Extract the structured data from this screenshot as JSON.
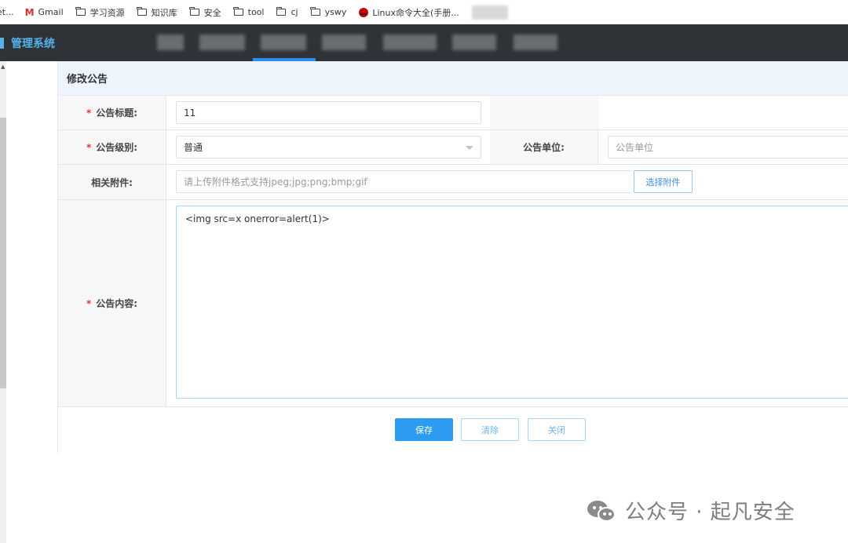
{
  "bookmarks": {
    "items": [
      {
        "label": "et...",
        "icon": "none"
      },
      {
        "label": "Gmail",
        "icon": "gmail-icon"
      },
      {
        "label": "学习资源",
        "icon": "folder-icon"
      },
      {
        "label": "知识库",
        "icon": "folder-icon"
      },
      {
        "label": "安全",
        "icon": "folder-icon"
      },
      {
        "label": "tool",
        "icon": "folder-icon"
      },
      {
        "label": "cj",
        "icon": "folder-icon"
      },
      {
        "label": "yswy",
        "icon": "folder-icon"
      },
      {
        "label": "Linux命令大全(手册...",
        "icon": "redhat-icon"
      }
    ]
  },
  "nav": {
    "brand": "管理系统",
    "colors": {
      "background": "#2f3237",
      "brand": "#55b2ea",
      "active": "#2d8cf0"
    }
  },
  "panel": {
    "title": "修改公告",
    "fields": {
      "title_label": "公告标题:",
      "title_value": "11",
      "level_label": "公告级别:",
      "level_value": "普通",
      "unit_label": "公告单位:",
      "unit_placeholder": "公告单位",
      "attachment_label": "相关附件:",
      "attachment_placeholder": "请上传附件格式支持jpeg;jpg;png;bmp;gif",
      "attachment_button": "选择附件",
      "content_label": "公告内容:",
      "content_value": "<img src=x onerror=alert(1)>"
    },
    "required_mark": "*",
    "buttons": {
      "save": "保存",
      "clear": "清除",
      "close": "关闭"
    }
  },
  "watermark": {
    "text": "公众号 · 起凡安全",
    "icon": "wechat-icon"
  }
}
